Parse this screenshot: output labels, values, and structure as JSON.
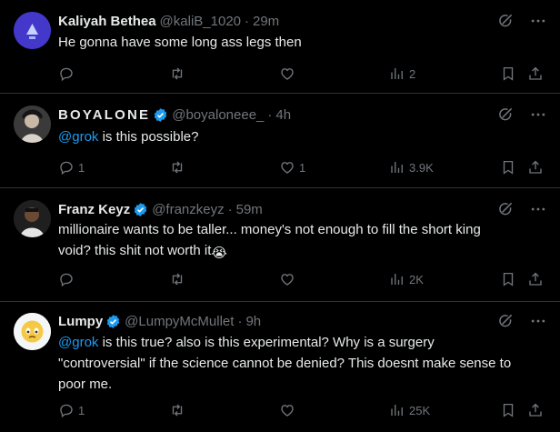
{
  "tweets": [
    {
      "name": "Kaliyah Bethea",
      "handle": "@kaliB_1020",
      "time": "29m",
      "text": "He gonna have some long ass legs then",
      "replies": "",
      "reposts": "",
      "likes": "",
      "views": "2"
    },
    {
      "name": "BOYALONE",
      "handle": "@boyaloneee_",
      "time": "4h",
      "mention": "@grok",
      "text": " is this possible?",
      "replies": "1",
      "reposts": "",
      "likes": "1",
      "views": "3.9K"
    },
    {
      "name": "Franz Keyz",
      "handle": "@franzkeyz",
      "time": "59m",
      "text_line1": "millionaire wants to be taller... money's not enough to fill the short king",
      "text_line2": "void? this shit not worth it",
      "emoji": "😭",
      "replies": "",
      "reposts": "",
      "likes": "",
      "views": "2K"
    },
    {
      "name": "Lumpy",
      "handle": "@LumpyMcMullet",
      "time": "9h",
      "mention": "@grok",
      "text_line1": " is this true? also is this experimental? Why is a surgery",
      "text_line2": "\"controversial\" if the science cannot be denied? This doesnt make sense to",
      "text_line3": "poor me.",
      "replies": "1",
      "reposts": "",
      "likes": "",
      "views": "25K"
    }
  ],
  "colors": {
    "background": "#000000",
    "text": "#e7e9ea",
    "muted": "#71767b",
    "accent": "#1d9bf0",
    "divider": "#2f3336"
  }
}
